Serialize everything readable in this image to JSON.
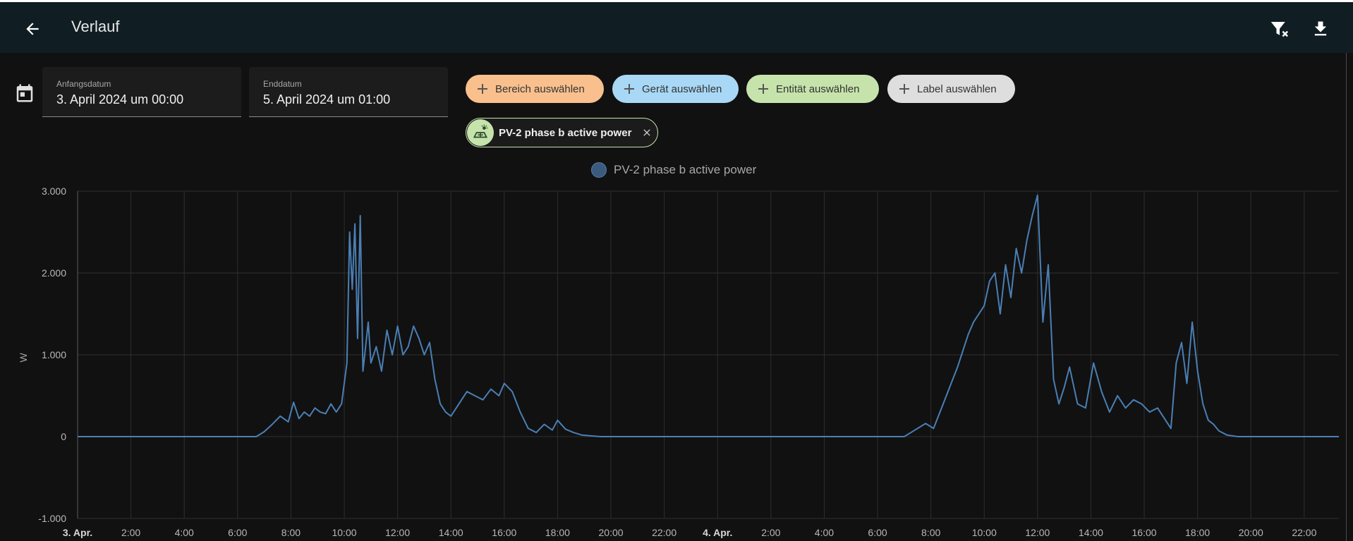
{
  "header": {
    "title": "Verlauf"
  },
  "date_range": {
    "start": {
      "label": "Anfangsdatum",
      "value": "3. April 2024 um 00:00"
    },
    "end": {
      "label": "Enddatum",
      "value": "5. April 2024 um 01:00"
    }
  },
  "target_picker": {
    "area": "Bereich auswählen",
    "device": "Gerät auswählen",
    "entity": "Entität auswählen",
    "label": "Label auswählen"
  },
  "selected_entity": {
    "name": "PV-2 phase b active power"
  },
  "colors": {
    "accent_line": "#4a7fb5",
    "chip_area": "#f9c08d",
    "chip_device": "#a8d8f6",
    "chip_entity": "#c6e3ac",
    "chip_label": "#dedede"
  },
  "chart_data": {
    "type": "line",
    "ylabel": "W",
    "y_tick_labels": [
      "3.000",
      "2.000",
      "1.000",
      "0",
      "-1.000"
    ],
    "y_ticks": [
      3000,
      2000,
      1000,
      0,
      -1000
    ],
    "ylim": [
      -1000,
      3000
    ],
    "x_tick_labels": [
      "3. Apr.",
      "2:00",
      "4:00",
      "6:00",
      "8:00",
      "10:00",
      "12:00",
      "14:00",
      "16:00",
      "18:00",
      "20:00",
      "22:00",
      "4. Apr.",
      "2:00",
      "4:00",
      "6:00",
      "8:00",
      "10:00",
      "12:00",
      "14:00",
      "16:00",
      "18:00",
      "20:00",
      "22:00"
    ],
    "x_tick_hours": [
      0,
      2,
      4,
      6,
      8,
      10,
      12,
      14,
      16,
      18,
      20,
      22,
      24,
      26,
      28,
      30,
      32,
      34,
      36,
      38,
      40,
      42,
      44,
      46
    ],
    "x_bold_ticks": [
      "3. Apr.",
      "4. Apr."
    ],
    "xlim_hours": [
      0,
      47.3
    ],
    "grid": true,
    "legend": "top-center",
    "series": [
      {
        "name": "PV-2 phase b active power",
        "x_hours": [
          0,
          6.7,
          7.0,
          7.3,
          7.6,
          7.9,
          8.1,
          8.3,
          8.5,
          8.7,
          8.9,
          9.1,
          9.3,
          9.5,
          9.7,
          9.9,
          10.1,
          10.2,
          10.3,
          10.4,
          10.5,
          10.6,
          10.7,
          10.8,
          10.9,
          11.0,
          11.2,
          11.4,
          11.6,
          11.8,
          12.0,
          12.2,
          12.4,
          12.6,
          12.8,
          13.0,
          13.2,
          13.4,
          13.6,
          13.8,
          14.0,
          14.3,
          14.6,
          14.9,
          15.2,
          15.5,
          15.8,
          16.0,
          16.3,
          16.6,
          16.9,
          17.2,
          17.5,
          17.8,
          18.0,
          18.3,
          18.6,
          18.9,
          19.2,
          19.6,
          20.0,
          31.0,
          31.4,
          31.8,
          32.1,
          32.4,
          32.7,
          33.0,
          33.2,
          33.4,
          33.6,
          33.8,
          34.0,
          34.2,
          34.4,
          34.6,
          34.8,
          35.0,
          35.2,
          35.4,
          35.6,
          35.8,
          36.0,
          36.2,
          36.4,
          36.6,
          36.8,
          37.0,
          37.2,
          37.5,
          37.8,
          38.1,
          38.4,
          38.7,
          39.0,
          39.3,
          39.6,
          39.9,
          40.2,
          40.5,
          40.8,
          41.0,
          41.2,
          41.4,
          41.6,
          41.8,
          42.0,
          42.2,
          42.4,
          42.6,
          42.8,
          43.1,
          43.5,
          44.0,
          47.3
        ],
        "values": [
          0,
          0,
          60,
          150,
          250,
          180,
          420,
          220,
          300,
          250,
          350,
          300,
          280,
          400,
          300,
          400,
          900,
          2500,
          1800,
          2600,
          1200,
          2700,
          800,
          1100,
          1400,
          900,
          1100,
          800,
          1300,
          1000,
          1350,
          1000,
          1100,
          1350,
          1200,
          1000,
          1150,
          700,
          400,
          300,
          250,
          400,
          550,
          500,
          450,
          580,
          500,
          650,
          550,
          300,
          100,
          50,
          150,
          80,
          200,
          90,
          50,
          20,
          10,
          0,
          0,
          0,
          80,
          160,
          100,
          350,
          600,
          850,
          1050,
          1250,
          1400,
          1500,
          1600,
          1900,
          2000,
          1500,
          2100,
          1700,
          2300,
          2000,
          2400,
          2700,
          2950,
          1400,
          2100,
          700,
          400,
          600,
          850,
          400,
          350,
          900,
          550,
          300,
          500,
          350,
          450,
          400,
          300,
          350,
          200,
          100,
          900,
          1150,
          650,
          1400,
          800,
          400,
          200,
          150,
          70,
          20,
          0,
          0,
          0
        ]
      }
    ]
  }
}
